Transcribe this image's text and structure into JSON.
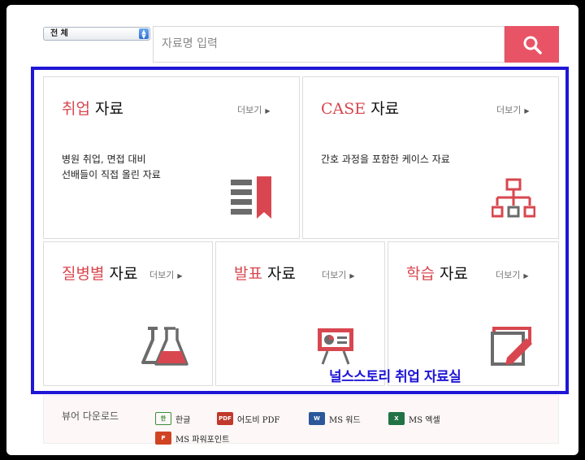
{
  "search": {
    "category_value": "전  체",
    "placeholder": "자료명 입력"
  },
  "cards": [
    {
      "accent": "취업",
      "plain": " 자료",
      "more": "더보기",
      "desc": [
        "병원 취업, 면접 대비",
        "선배들이 직접 올린 자료"
      ],
      "icon": "bookmark-list-icon"
    },
    {
      "accent": "CASE",
      "plain": " 자료",
      "more": "더보기",
      "desc": [
        "간호 과정을 포함한 케이스 자료"
      ],
      "icon": "sitemap-icon"
    },
    {
      "accent": "질병별",
      "plain": " 자료",
      "more": "더보기",
      "icon": "flask-icon"
    },
    {
      "accent": "발표",
      "plain": " 자료",
      "more": "더보기",
      "icon": "presentation-board-icon"
    },
    {
      "accent": "학습",
      "plain": " 자료",
      "more": "더보기",
      "icon": "edit-document-icon"
    }
  ],
  "annotation": "널스스토리 취업 자료실",
  "viewer": {
    "title": "뷰어 다운로드",
    "items": [
      {
        "label": "한글",
        "icon": "hangul-viewer-icon",
        "color": "#3a8f3a"
      },
      {
        "label": "어도비 PDF",
        "icon": "pdf-icon",
        "color": "#c0392b"
      },
      {
        "label": "MS 워드",
        "icon": "word-icon",
        "color": "#2b579a"
      },
      {
        "label": "MS 엑셀",
        "icon": "excel-icon",
        "color": "#217346"
      },
      {
        "label": "MS 파워포인트",
        "icon": "powerpoint-icon",
        "color": "#d04423"
      }
    ]
  },
  "colors": {
    "accent": "#d8474f",
    "search_button": "#e85466",
    "annotation": "#1f16d6",
    "icon_gray": "#6b6b6b"
  }
}
